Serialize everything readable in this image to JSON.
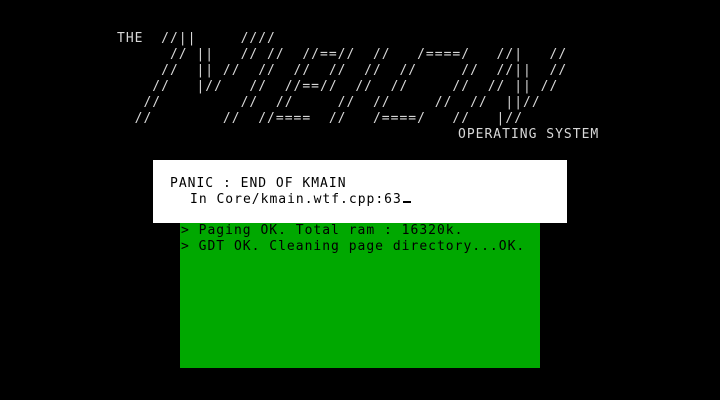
{
  "logo": {
    "lines": [
      "THE  //||     ////",
      "      // ||   // //  //==//  //   /====/   //|   //",
      "     //  || //  //  //  //  //  //     //  //||  //",
      "    //   |//   //  //==//  //  //     //  // || //",
      "   //         //  //     //  //     //  //  ||//",
      "  //        //  //====  //   /====/   //   |//"
    ],
    "subtitle": "OPERATING SYSTEM"
  },
  "console": {
    "lines": [
      "> Paging OK. Total ram : 16320k.",
      "> GDT OK. Cleaning page directory...OK."
    ],
    "background_color": "#00a800"
  },
  "panic": {
    "title": "PANIC : END OF KMAIN",
    "location": "In Core/kmain.wtf.cpp:63",
    "background_color": "#ffffff"
  }
}
